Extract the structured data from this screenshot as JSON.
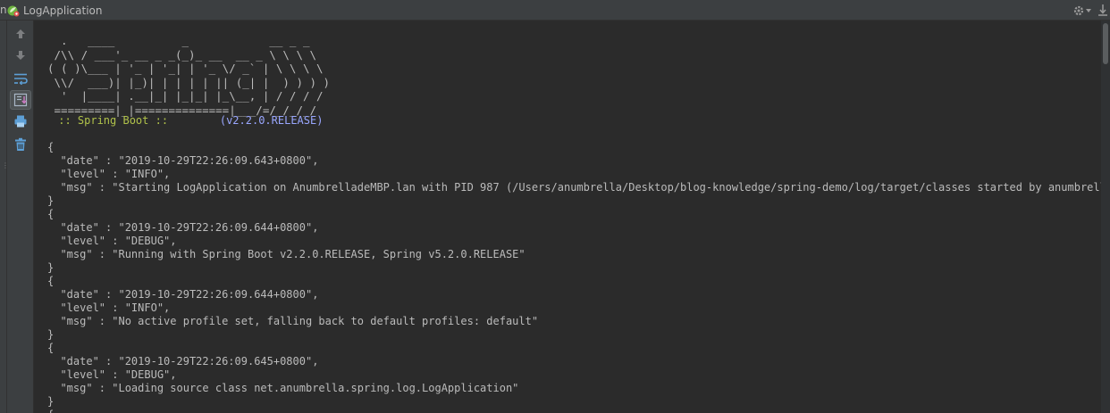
{
  "header": {
    "tab_fragment": "n",
    "tab_title": "LogApplication"
  },
  "banner": {
    "lines": [
      "  .   ____          _            __ _ _",
      " /\\\\ / ___'_ __ _ _(_)_ __  __ _ \\ \\ \\ \\",
      "( ( )\\___ | '_ | '_| | '_ \\/ _` | \\ \\ \\ \\",
      " \\\\/  ___)| |_)| | | | | || (_| |  ) ) ) )",
      "  '  |____| .__|_| |_|_| |_\\__, | / / / /",
      " =========|_|==============|___/=/_/_/_/"
    ],
    "boot_label": " :: Spring Boot :: ",
    "boot_version": "       (v2.2.0.RELEASE)"
  },
  "console": {
    "lines": [
      "{",
      "  \"date\" : \"2019-10-29T22:26:09.643+0800\",",
      "  \"level\" : \"INFO\",",
      "  \"msg\" : \"Starting LogApplication on AnumbrelladeMBP.lan with PID 987 (/Users/anumbrella/Desktop/blog-knowledge/spring-demo/log/target/classes started by anumbrella in /",
      "}",
      "{",
      "  \"date\" : \"2019-10-29T22:26:09.644+0800\",",
      "  \"level\" : \"DEBUG\",",
      "  \"msg\" : \"Running with Spring Boot v2.2.0.RELEASE, Spring v5.2.0.RELEASE\"",
      "}",
      "{",
      "  \"date\" : \"2019-10-29T22:26:09.644+0800\",",
      "  \"level\" : \"INFO\",",
      "  \"msg\" : \"No active profile set, falling back to default profiles: default\"",
      "}",
      "{",
      "  \"date\" : \"2019-10-29T22:26:09.645+0800\",",
      "  \"level\" : \"DEBUG\",",
      "  \"msg\" : \"Loading source class net.anumbrella.spring.log.LogApplication\"",
      "}",
      "{"
    ]
  },
  "toolbar": {
    "icons": [
      "arrow-up-icon",
      "arrow-down-icon",
      "soft-wrap-icon",
      "scroll-to-end-icon",
      "print-icon",
      "trash-icon"
    ]
  },
  "colors": {
    "background": "#2b2b2b",
    "panel": "#3c3f41",
    "text": "#bbbbbb",
    "boot_label": "#b0c24a",
    "boot_version": "#9aa7ff"
  }
}
